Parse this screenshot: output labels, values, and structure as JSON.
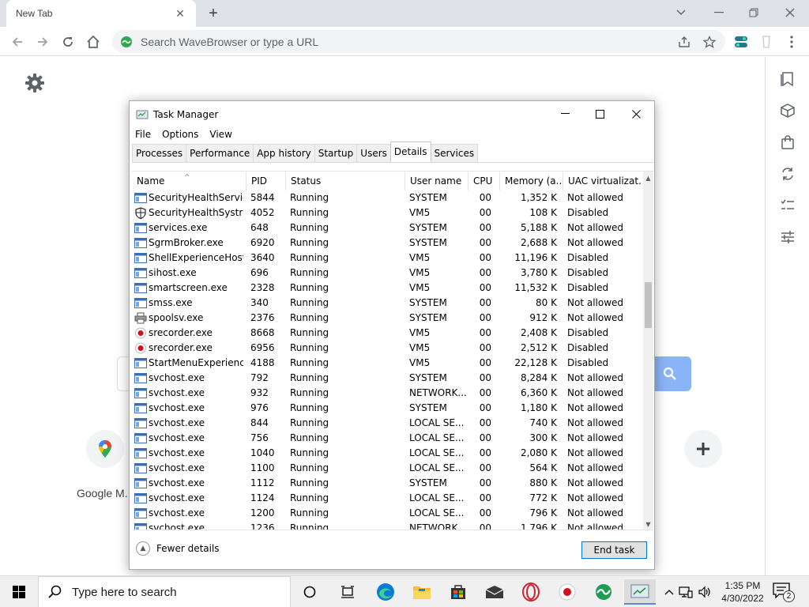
{
  "browser": {
    "tab_title": "New Tab",
    "omnibox_placeholder": "Search WaveBrowser or type a URL"
  },
  "newtab": {
    "shortcuts": [
      {
        "label": "Google M...",
        "icon": "google-maps-icon"
      },
      {
        "label": "",
        "icon": "add-shortcut-icon"
      }
    ]
  },
  "task_manager": {
    "title": "Task Manager",
    "menu": [
      "File",
      "Options",
      "View"
    ],
    "tabs": [
      "Processes",
      "Performance",
      "App history",
      "Startup",
      "Users",
      "Details",
      "Services"
    ],
    "active_tab": "Details",
    "columns": [
      "Name",
      "PID",
      "Status",
      "User name",
      "CPU",
      "Memory (a...",
      "UAC virtualizat..."
    ],
    "rows": [
      {
        "icon": "window-icon",
        "name": "SecurityHealthServic...",
        "pid": "5844",
        "status": "Running",
        "user": "SYSTEM",
        "cpu": "00",
        "mem": "1,352 K",
        "uac": "Not allowed"
      },
      {
        "icon": "shield-icon",
        "name": "SecurityHealthSystra...",
        "pid": "4052",
        "status": "Running",
        "user": "VM5",
        "cpu": "00",
        "mem": "108 K",
        "uac": "Disabled"
      },
      {
        "icon": "window-icon",
        "name": "services.exe",
        "pid": "648",
        "status": "Running",
        "user": "SYSTEM",
        "cpu": "00",
        "mem": "5,188 K",
        "uac": "Not allowed"
      },
      {
        "icon": "window-icon",
        "name": "SgrmBroker.exe",
        "pid": "6920",
        "status": "Running",
        "user": "SYSTEM",
        "cpu": "00",
        "mem": "2,688 K",
        "uac": "Not allowed"
      },
      {
        "icon": "window-icon",
        "name": "ShellExperienceHost....",
        "pid": "3640",
        "status": "Running",
        "user": "VM5",
        "cpu": "00",
        "mem": "11,196 K",
        "uac": "Disabled"
      },
      {
        "icon": "window-icon",
        "name": "sihost.exe",
        "pid": "696",
        "status": "Running",
        "user": "VM5",
        "cpu": "00",
        "mem": "3,780 K",
        "uac": "Disabled"
      },
      {
        "icon": "window-icon",
        "name": "smartscreen.exe",
        "pid": "2328",
        "status": "Running",
        "user": "VM5",
        "cpu": "00",
        "mem": "11,532 K",
        "uac": "Disabled"
      },
      {
        "icon": "window-icon",
        "name": "smss.exe",
        "pid": "340",
        "status": "Running",
        "user": "SYSTEM",
        "cpu": "00",
        "mem": "80 K",
        "uac": "Not allowed"
      },
      {
        "icon": "printer-icon",
        "name": "spoolsv.exe",
        "pid": "2376",
        "status": "Running",
        "user": "SYSTEM",
        "cpu": "00",
        "mem": "912 K",
        "uac": "Not allowed"
      },
      {
        "icon": "record-icon",
        "name": "srecorder.exe",
        "pid": "8668",
        "status": "Running",
        "user": "VM5",
        "cpu": "00",
        "mem": "2,408 K",
        "uac": "Disabled"
      },
      {
        "icon": "record-icon",
        "name": "srecorder.exe",
        "pid": "6956",
        "status": "Running",
        "user": "VM5",
        "cpu": "00",
        "mem": "2,512 K",
        "uac": "Disabled"
      },
      {
        "icon": "window-icon",
        "name": "StartMenuExperienc...",
        "pid": "4188",
        "status": "Running",
        "user": "VM5",
        "cpu": "00",
        "mem": "22,128 K",
        "uac": "Disabled"
      },
      {
        "icon": "window-icon",
        "name": "svchost.exe",
        "pid": "792",
        "status": "Running",
        "user": "SYSTEM",
        "cpu": "00",
        "mem": "8,284 K",
        "uac": "Not allowed"
      },
      {
        "icon": "window-icon",
        "name": "svchost.exe",
        "pid": "932",
        "status": "Running",
        "user": "NETWORK...",
        "cpu": "00",
        "mem": "6,360 K",
        "uac": "Not allowed"
      },
      {
        "icon": "window-icon",
        "name": "svchost.exe",
        "pid": "976",
        "status": "Running",
        "user": "SYSTEM",
        "cpu": "00",
        "mem": "1,180 K",
        "uac": "Not allowed"
      },
      {
        "icon": "window-icon",
        "name": "svchost.exe",
        "pid": "844",
        "status": "Running",
        "user": "LOCAL SE...",
        "cpu": "00",
        "mem": "740 K",
        "uac": "Not allowed"
      },
      {
        "icon": "window-icon",
        "name": "svchost.exe",
        "pid": "756",
        "status": "Running",
        "user": "LOCAL SE...",
        "cpu": "00",
        "mem": "300 K",
        "uac": "Not allowed"
      },
      {
        "icon": "window-icon",
        "name": "svchost.exe",
        "pid": "1040",
        "status": "Running",
        "user": "LOCAL SE...",
        "cpu": "00",
        "mem": "2,080 K",
        "uac": "Not allowed"
      },
      {
        "icon": "window-icon",
        "name": "svchost.exe",
        "pid": "1100",
        "status": "Running",
        "user": "LOCAL SE...",
        "cpu": "00",
        "mem": "564 K",
        "uac": "Not allowed"
      },
      {
        "icon": "window-icon",
        "name": "svchost.exe",
        "pid": "1112",
        "status": "Running",
        "user": "SYSTEM",
        "cpu": "00",
        "mem": "880 K",
        "uac": "Not allowed"
      },
      {
        "icon": "window-icon",
        "name": "svchost.exe",
        "pid": "1124",
        "status": "Running",
        "user": "LOCAL SE...",
        "cpu": "00",
        "mem": "772 K",
        "uac": "Not allowed"
      },
      {
        "icon": "window-icon",
        "name": "svchost.exe",
        "pid": "1200",
        "status": "Running",
        "user": "LOCAL SE...",
        "cpu": "00",
        "mem": "796 K",
        "uac": "Not allowed"
      },
      {
        "icon": "window-icon",
        "name": "svchost.exe",
        "pid": "1236",
        "status": "Running",
        "user": "NETWORK...",
        "cpu": "00",
        "mem": "1,796 K",
        "uac": "Not allowed"
      }
    ],
    "fewer_details": "Fewer details",
    "end_task": "End task"
  },
  "taskbar": {
    "search_placeholder": "Type here to search",
    "time": "1:35 PM",
    "date": "4/30/2022",
    "notification_count": "2"
  },
  "colors": {
    "accent": "#0078d7",
    "search_button": "#8ab4f8",
    "tabstrip": "#dee1e6"
  }
}
